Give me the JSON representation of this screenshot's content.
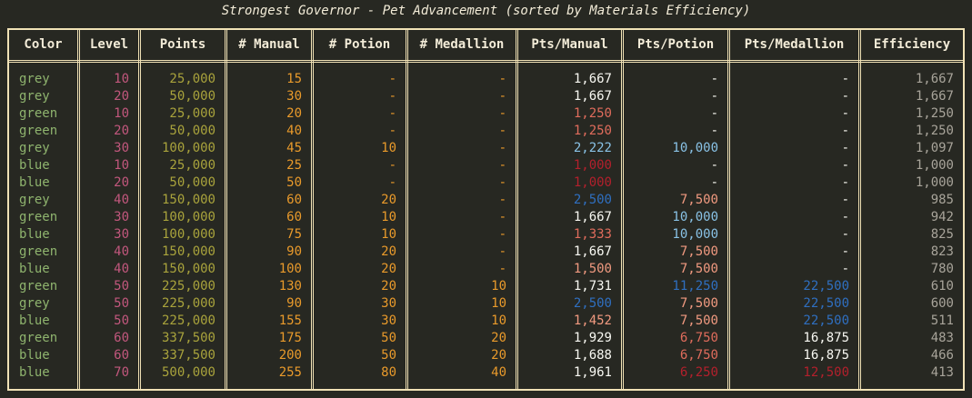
{
  "title": "Strongest Governor - Pet Advancement (sorted by Materials Efficiency)",
  "columns": [
    {
      "key": "color",
      "label": "Color"
    },
    {
      "key": "level",
      "label": "Level"
    },
    {
      "key": "points",
      "label": "Points"
    },
    {
      "key": "manual",
      "label": "# Manual"
    },
    {
      "key": "potion",
      "label": "# Potion"
    },
    {
      "key": "medallion",
      "label": "# Medallion"
    },
    {
      "key": "pts_manual",
      "label": "Pts/Manual"
    },
    {
      "key": "pts_potion",
      "label": "Pts/Potion"
    },
    {
      "key": "pts_medallion",
      "label": "Pts/Medallion"
    },
    {
      "key": "efficiency",
      "label": "Efficiency"
    }
  ],
  "colors": {
    "color_col": "#8fb46e",
    "level": "#c2577d",
    "points": "#a9a33c",
    "counts": "#e99a2b",
    "white": "#f8f8f2",
    "red_light": "#e06c5c",
    "red_dark": "#b3202c",
    "blue_dark": "#2f6fc0",
    "blue_light": "#89c2e6",
    "salmon": "#f19a80",
    "efficiency": "#a8a49a"
  },
  "rows": [
    {
      "color": "grey",
      "level": "10",
      "points": "25,000",
      "manual": "15",
      "potion": "-",
      "medallion": "-",
      "pts_manual": "1,667",
      "pm_c": "white",
      "pts_potion": "-",
      "pp_c": "white",
      "pts_medallion": "-",
      "pd_c": "white",
      "efficiency": "1,667"
    },
    {
      "color": "grey",
      "level": "20",
      "points": "50,000",
      "manual": "30",
      "potion": "-",
      "medallion": "-",
      "pts_manual": "1,667",
      "pm_c": "white",
      "pts_potion": "-",
      "pp_c": "white",
      "pts_medallion": "-",
      "pd_c": "white",
      "efficiency": "1,667"
    },
    {
      "color": "green",
      "level": "10",
      "points": "25,000",
      "manual": "20",
      "potion": "-",
      "medallion": "-",
      "pts_manual": "1,250",
      "pm_c": "red_light",
      "pts_potion": "-",
      "pp_c": "white",
      "pts_medallion": "-",
      "pd_c": "white",
      "efficiency": "1,250"
    },
    {
      "color": "green",
      "level": "20",
      "points": "50,000",
      "manual": "40",
      "potion": "-",
      "medallion": "-",
      "pts_manual": "1,250",
      "pm_c": "red_light",
      "pts_potion": "-",
      "pp_c": "white",
      "pts_medallion": "-",
      "pd_c": "white",
      "efficiency": "1,250"
    },
    {
      "color": "grey",
      "level": "30",
      "points": "100,000",
      "manual": "45",
      "potion": "10",
      "medallion": "-",
      "pts_manual": "2,222",
      "pm_c": "blue_light",
      "pts_potion": "10,000",
      "pp_c": "blue_light",
      "pts_medallion": "-",
      "pd_c": "white",
      "efficiency": "1,097"
    },
    {
      "color": "blue",
      "level": "10",
      "points": "25,000",
      "manual": "25",
      "potion": "-",
      "medallion": "-",
      "pts_manual": "1,000",
      "pm_c": "red_dark",
      "pts_potion": "-",
      "pp_c": "white",
      "pts_medallion": "-",
      "pd_c": "white",
      "efficiency": "1,000"
    },
    {
      "color": "blue",
      "level": "20",
      "points": "50,000",
      "manual": "50",
      "potion": "-",
      "medallion": "-",
      "pts_manual": "1,000",
      "pm_c": "red_dark",
      "pts_potion": "-",
      "pp_c": "white",
      "pts_medallion": "-",
      "pd_c": "white",
      "efficiency": "1,000"
    },
    {
      "color": "grey",
      "level": "40",
      "points": "150,000",
      "manual": "60",
      "potion": "20",
      "medallion": "-",
      "pts_manual": "2,500",
      "pm_c": "blue_dark",
      "pts_potion": "7,500",
      "pp_c": "salmon",
      "pts_medallion": "-",
      "pd_c": "white",
      "efficiency": "985"
    },
    {
      "color": "green",
      "level": "30",
      "points": "100,000",
      "manual": "60",
      "potion": "10",
      "medallion": "-",
      "pts_manual": "1,667",
      "pm_c": "white",
      "pts_potion": "10,000",
      "pp_c": "blue_light",
      "pts_medallion": "-",
      "pd_c": "white",
      "efficiency": "942"
    },
    {
      "color": "blue",
      "level": "30",
      "points": "100,000",
      "manual": "75",
      "potion": "10",
      "medallion": "-",
      "pts_manual": "1,333",
      "pm_c": "red_light",
      "pts_potion": "10,000",
      "pp_c": "blue_light",
      "pts_medallion": "-",
      "pd_c": "white",
      "efficiency": "825"
    },
    {
      "color": "green",
      "level": "40",
      "points": "150,000",
      "manual": "90",
      "potion": "20",
      "medallion": "-",
      "pts_manual": "1,667",
      "pm_c": "white",
      "pts_potion": "7,500",
      "pp_c": "salmon",
      "pts_medallion": "-",
      "pd_c": "white",
      "efficiency": "823"
    },
    {
      "color": "blue",
      "level": "40",
      "points": "150,000",
      "manual": "100",
      "potion": "20",
      "medallion": "-",
      "pts_manual": "1,500",
      "pm_c": "salmon",
      "pts_potion": "7,500",
      "pp_c": "salmon",
      "pts_medallion": "-",
      "pd_c": "white",
      "efficiency": "780"
    },
    {
      "color": "green",
      "level": "50",
      "points": "225,000",
      "manual": "130",
      "potion": "20",
      "medallion": "10",
      "pts_manual": "1,731",
      "pm_c": "white",
      "pts_potion": "11,250",
      "pp_c": "blue_dark",
      "pts_medallion": "22,500",
      "pd_c": "blue_dark",
      "efficiency": "610"
    },
    {
      "color": "grey",
      "level": "50",
      "points": "225,000",
      "manual": "90",
      "potion": "30",
      "medallion": "10",
      "pts_manual": "2,500",
      "pm_c": "blue_dark",
      "pts_potion": "7,500",
      "pp_c": "salmon",
      "pts_medallion": "22,500",
      "pd_c": "blue_dark",
      "efficiency": "600"
    },
    {
      "color": "blue",
      "level": "50",
      "points": "225,000",
      "manual": "155",
      "potion": "30",
      "medallion": "10",
      "pts_manual": "1,452",
      "pm_c": "salmon",
      "pts_potion": "7,500",
      "pp_c": "salmon",
      "pts_medallion": "22,500",
      "pd_c": "blue_dark",
      "efficiency": "511"
    },
    {
      "color": "green",
      "level": "60",
      "points": "337,500",
      "manual": "175",
      "potion": "50",
      "medallion": "20",
      "pts_manual": "1,929",
      "pm_c": "white",
      "pts_potion": "6,750",
      "pp_c": "red_light",
      "pts_medallion": "16,875",
      "pd_c": "white",
      "efficiency": "483"
    },
    {
      "color": "blue",
      "level": "60",
      "points": "337,500",
      "manual": "200",
      "potion": "50",
      "medallion": "20",
      "pts_manual": "1,688",
      "pm_c": "white",
      "pts_potion": "6,750",
      "pp_c": "red_light",
      "pts_medallion": "16,875",
      "pd_c": "white",
      "efficiency": "466"
    },
    {
      "color": "blue",
      "level": "70",
      "points": "500,000",
      "manual": "255",
      "potion": "80",
      "medallion": "40",
      "pts_manual": "1,961",
      "pm_c": "white",
      "pts_potion": "6,250",
      "pp_c": "red_dark",
      "pts_medallion": "12,500",
      "pd_c": "red_dark",
      "efficiency": "413"
    }
  ]
}
